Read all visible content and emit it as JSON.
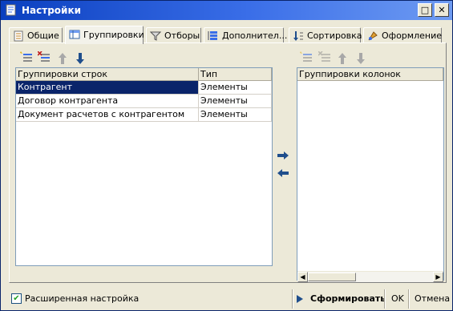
{
  "window": {
    "title": "Настройки",
    "maximize_glyph": "□",
    "close_glyph": "✕"
  },
  "tabs": [
    {
      "label": "Общие",
      "icon": "settings-list-icon"
    },
    {
      "label": "Группировки",
      "icon": "grouping-table-icon",
      "active": true
    },
    {
      "label": "Отборы",
      "icon": "filter-funnel-icon"
    },
    {
      "label": "Дополнител...",
      "icon": "additional-fields-icon"
    },
    {
      "label": "Сортировка",
      "icon": "sort-icon"
    },
    {
      "label": "Оформление",
      "icon": "appearance-palette-icon"
    }
  ],
  "row_groupings": {
    "columns": [
      "Группировки строк",
      "Тип"
    ],
    "rows": [
      {
        "name": "Контрагент",
        "type": "Элементы",
        "selected": true
      },
      {
        "name": "Договор контрагента",
        "type": "Элементы"
      },
      {
        "name": "Документ расчетов с контрагентом",
        "type": "Элементы"
      }
    ]
  },
  "column_groupings": {
    "columns": [
      "Группировки колонок"
    ],
    "rows": []
  },
  "bottom": {
    "extended_settings_label": "Расширенная настройка",
    "extended_settings_checked": true,
    "generate_label": "Сформировать",
    "ok_label": "OK",
    "cancel_label": "Отмена"
  },
  "colors": {
    "title_bar": "#0A3FBF",
    "selection": "#0A246A",
    "arrow_blue": "#1F4E8C"
  }
}
